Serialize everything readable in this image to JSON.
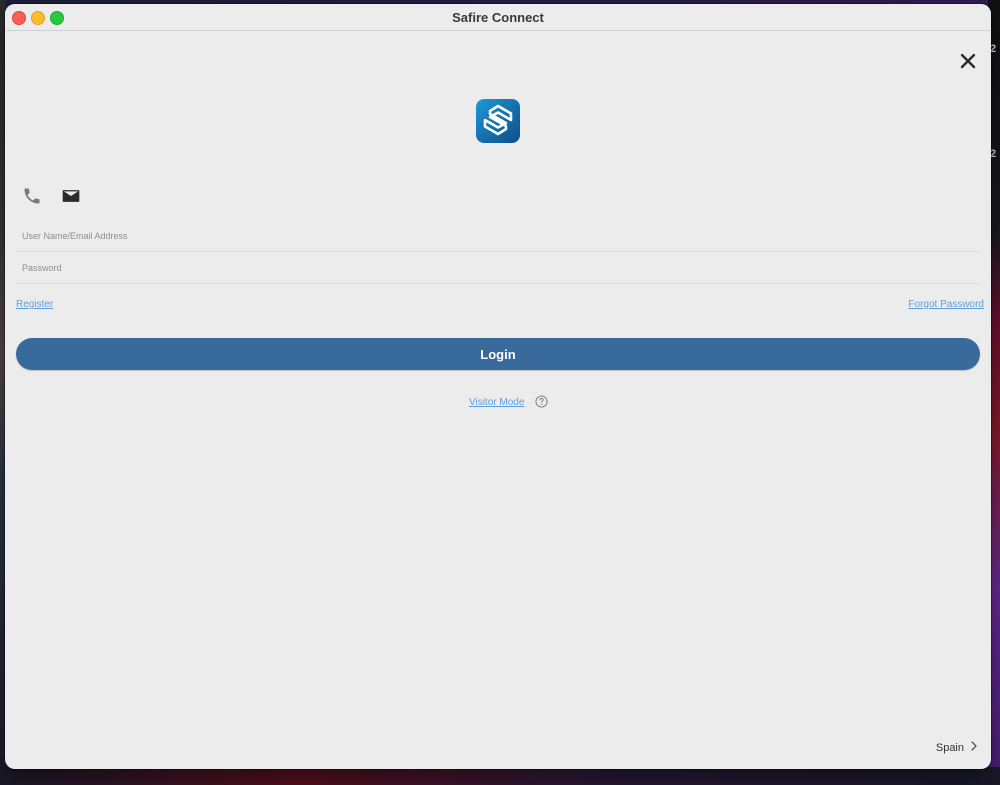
{
  "window": {
    "title": "Safire Connect"
  },
  "desktop": {
    "right_edge_chars": [
      "2",
      "2"
    ]
  },
  "login": {
    "username_placeholder": "User Name/Email Address",
    "password_placeholder": "Password",
    "register_label": "Register",
    "forgot_label": "Forgot Password",
    "login_label": "Login",
    "visitor_label": "Visitor Mode"
  },
  "footer": {
    "region": "Spain"
  },
  "icons": {
    "close": "close-icon",
    "logo": "safire-logo-icon",
    "phone": "phone-icon",
    "mail": "mail-icon",
    "help": "help-icon",
    "chevron": "chevron-right-icon"
  },
  "colors": {
    "accent": "#386b9c",
    "link": "#5a9fe0",
    "logo": "#1f9ad6"
  }
}
